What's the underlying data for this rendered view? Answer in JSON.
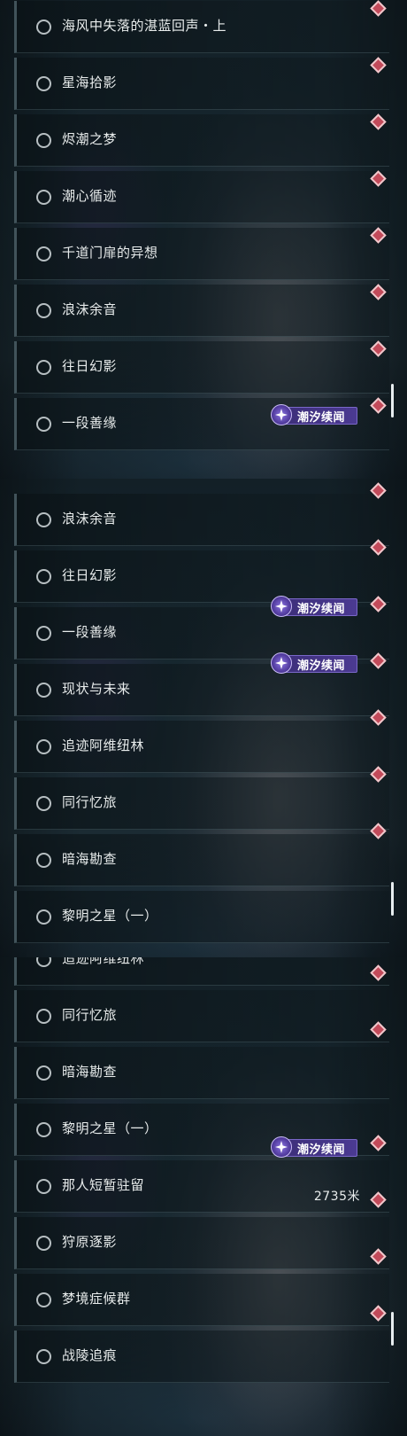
{
  "badge_label": "潮汐续闻",
  "panels": [
    {
      "rows": [
        {
          "label": "海风中失落的湛蓝回声・上"
        },
        {
          "label": "星海拾影"
        },
        {
          "label": "烬潮之梦"
        },
        {
          "label": "潮心循迹"
        },
        {
          "label": "千道门扉的异想"
        },
        {
          "label": "浪沫余音"
        },
        {
          "label": "往日幻影"
        },
        {
          "label": "一段善缘"
        }
      ]
    },
    {
      "rows": [
        {
          "label": "浪沫余音"
        },
        {
          "label": "往日幻影"
        },
        {
          "label": "一段善缘"
        },
        {
          "label": "现状与未来"
        },
        {
          "label": "追迹阿维纽林"
        },
        {
          "label": "同行忆旅"
        },
        {
          "label": "暗海勘查"
        },
        {
          "label": "黎明之星（一）"
        }
      ]
    },
    {
      "rows": [
        {
          "label": "追迹阿维纽林"
        },
        {
          "label": "同行忆旅"
        },
        {
          "label": "暗海勘查"
        },
        {
          "label": "黎明之星（一）"
        },
        {
          "label": "那人短暂驻留",
          "distance": "2735米"
        },
        {
          "label": "狩原逐影"
        },
        {
          "label": "梦境症候群"
        },
        {
          "label": "战陵追痕"
        }
      ]
    }
  ],
  "icons": {
    "radio": "radio-unselected-icon",
    "marker": "quest-marker-diamond-icon",
    "badge": "sparkle-star-icon"
  },
  "colors": {
    "marker": "#c24a5a",
    "badge_bg": "#4b3a92",
    "row_accent": "#41535a"
  }
}
